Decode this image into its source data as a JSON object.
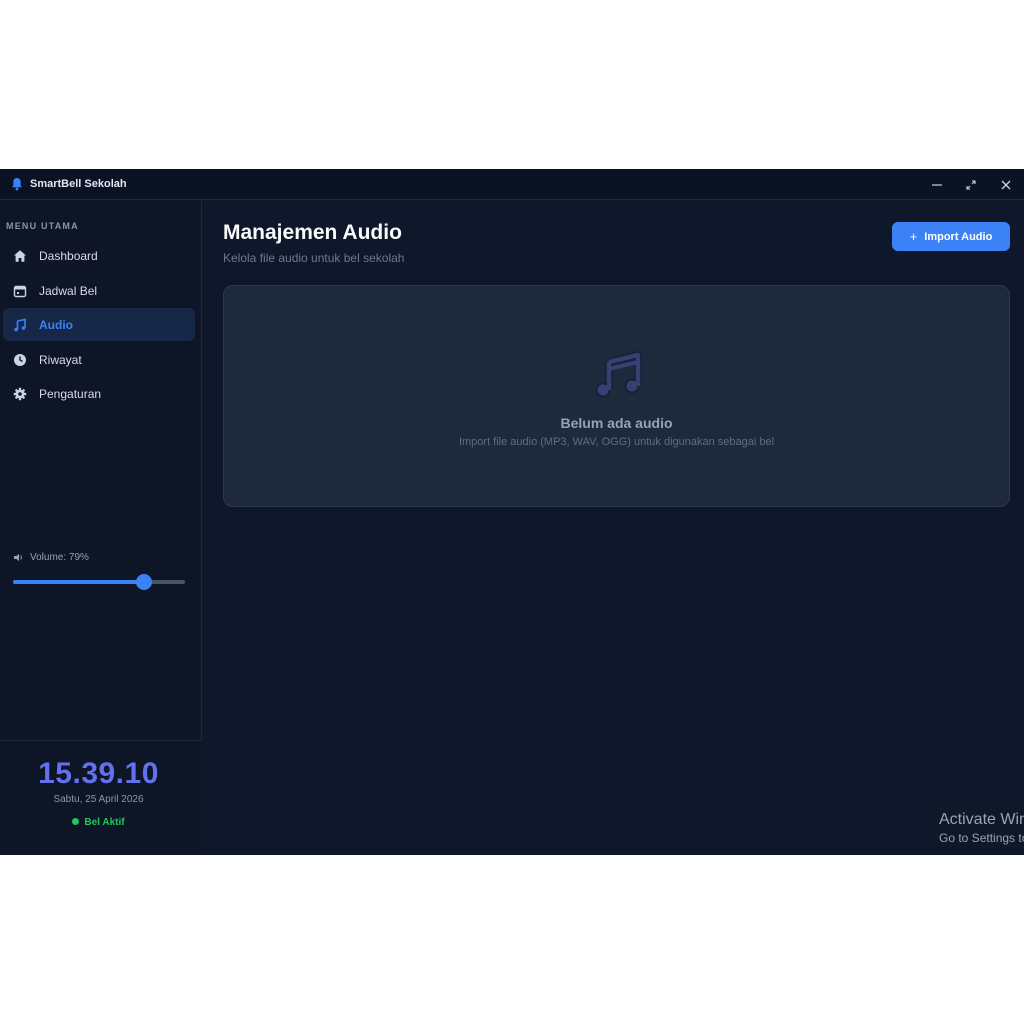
{
  "window": {
    "title": "SmartBell Sekolah",
    "controls": {
      "minimize_icon": "minimize-icon",
      "maximize_icon": "maximize-icon",
      "close_icon": "close-icon"
    }
  },
  "sidebar": {
    "menu_label": "MENU UTAMA",
    "items": [
      {
        "label": "Dashboard",
        "icon": "home-icon",
        "active": false
      },
      {
        "label": "Jadwal Bel",
        "icon": "calendar-icon",
        "active": false
      },
      {
        "label": "Audio",
        "icon": "music-note-icon",
        "active": true
      },
      {
        "label": "Riwayat",
        "icon": "clock-icon",
        "active": false
      },
      {
        "label": "Pengaturan",
        "icon": "gear-icon",
        "active": false
      }
    ],
    "volume": {
      "label": "Volume: 79%",
      "value": 0.76
    },
    "clock": {
      "time": "15.39.10",
      "date": "Sabtu, 25 April 2026",
      "status": "Bel Aktif"
    }
  },
  "main": {
    "title": "Manajemen Audio",
    "subtitle": "Kelola file audio untuk bel sekolah",
    "import_button": "Import Audio",
    "empty_state": {
      "icon": "music-icon",
      "title": "Belum ada audio",
      "description": "Import file audio (MP3, WAV, OGG) untuk digunakan sebagai bel"
    }
  },
  "watermark": {
    "line1": "Activate Windows",
    "line2": "Go to Settings to activate Windows."
  },
  "colors": {
    "accent": "#3b82f6",
    "background": "#0f172a",
    "sidebar": "#0d1526",
    "card": "#1e293b",
    "status_green": "#22c55e",
    "clock": "#6371ee"
  }
}
